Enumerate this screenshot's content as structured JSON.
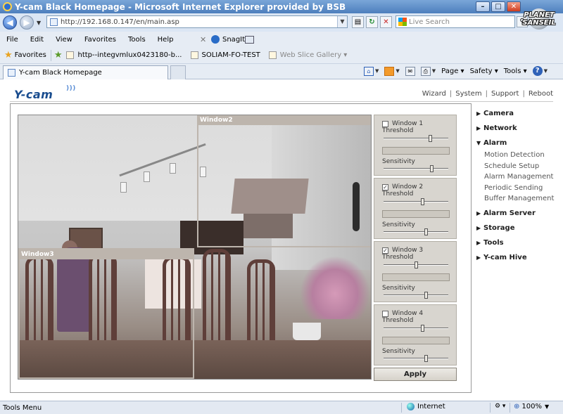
{
  "browser": {
    "title": "Y-cam Black Homepage - Microsoft Internet Explorer provided by BSB",
    "url": "http://192.168.0.147/en/main.asp",
    "search_placeholder": "Live Search",
    "menu": [
      "File",
      "Edit",
      "View",
      "Favorites",
      "Tools",
      "Help"
    ],
    "snagit_label": "SnagIt",
    "favorites_label": "Favorites",
    "favorites": [
      {
        "label": "http--integvmlux0423180-b...",
        "dimmed": false
      },
      {
        "label": "SOLIAM-FO-TEST",
        "dimmed": false
      },
      {
        "label": "Web Slice Gallery ▾",
        "dimmed": true
      }
    ],
    "tab_title": "Y-cam Black Homepage",
    "commands": {
      "page": "Page",
      "safety": "Safety",
      "tools": "Tools"
    },
    "watermark": {
      "line1": "PLANET",
      "line2": "SANSEIL"
    }
  },
  "page": {
    "logo": "Y-cam",
    "topnav": [
      "Wizard",
      "System",
      "Support",
      "Reboot"
    ],
    "video": {
      "window2_label": "Window2",
      "window3_label": "Window3"
    },
    "panels": [
      {
        "label": "Window 1",
        "checked": false,
        "threshold_label": "Threshold",
        "sensitivity_label": "Sensitivity",
        "threshold": 0.75,
        "sensitivity": 0.78
      },
      {
        "label": "Window 2",
        "checked": true,
        "threshold_label": "Threshold",
        "sensitivity_label": "Sensitivity",
        "threshold": 0.62,
        "sensitivity": 0.68
      },
      {
        "label": "Window 3",
        "checked": true,
        "threshold_label": "Threshold",
        "sensitivity_label": "Sensitivity",
        "threshold": 0.52,
        "sensitivity": 0.68
      },
      {
        "label": "Window 4",
        "checked": false,
        "threshold_label": "Threshold",
        "sensitivity_label": "Sensitivity",
        "threshold": 0.62,
        "sensitivity": 0.68
      }
    ],
    "apply_label": "Apply",
    "sidebar": {
      "camera": "Camera",
      "network": "Network",
      "alarm": "Alarm",
      "alarm_subs": [
        "Motion Detection",
        "Schedule Setup",
        "Alarm Management",
        "Periodic Sending",
        "Buffer Management"
      ],
      "alarm_server": "Alarm Server",
      "storage": "Storage",
      "tools": "Tools",
      "hive": "Y-cam Hive"
    }
  },
  "status": {
    "text": "Tools Menu",
    "zone": "Internet",
    "zoom": "100%"
  },
  "colors": {
    "titlebar": "#4d7fbd",
    "panel_bg": "#d8d5cf",
    "window_overlay": "#bdb5ad",
    "logo": "#1a4d8f"
  }
}
